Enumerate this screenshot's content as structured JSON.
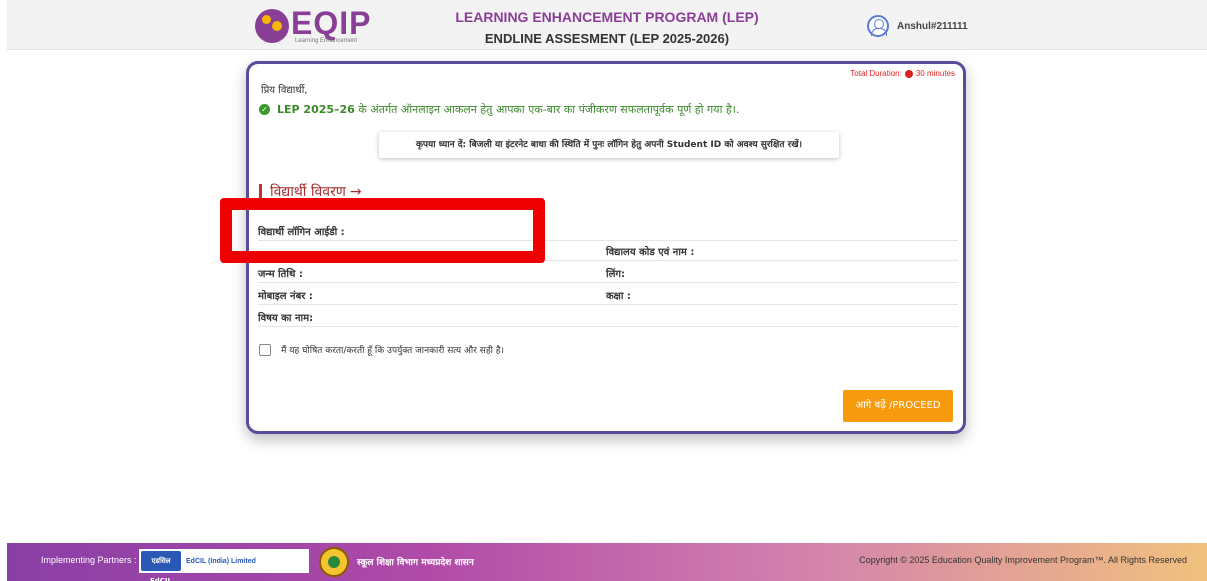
{
  "header": {
    "logo_text": "EQIP",
    "logo_subtitle": "Learning Enhancement",
    "title_line1": "LEARNING ENHANCEMENT PROGRAM (LEP)",
    "title_line2": "ENDLINE ASSESMENT (LEP 2025-2026)",
    "username": "Anshul#211111"
  },
  "card": {
    "duration_label": "Total Duration:",
    "duration_value": "30 minutes",
    "greeting": "प्रिय विद्यार्थी,",
    "success_bold": "LEP 2025–26",
    "success_message": "के अंतर्गत ऑनलाइन आकलन हेतु आपका एक-बार का पंजीकरण सफलतापूर्वक पूर्ण हो गया है।.",
    "notice": "कृपया ध्यान दें: बिजली या इंटरनेट बाधा की स्थिति में पुनः लॉगिन हेतु अपनी Student ID को अवश्य सुरक्षित रखें।",
    "section_title": "विद्यार्थी विवरण",
    "section_arrow": "→",
    "fields": {
      "login_id": "विद्यार्थी लॉगिन आईडी :",
      "school": "विद्यालय कोड एवं नाम :",
      "dob": "जन्म तिथि :",
      "gender": "लिंग:",
      "mobile": "मोबाइल नंबर :",
      "class": "कक्षा :",
      "subject": "विषय का नाम:"
    },
    "declaration": "मैं यह घोषित करता/करती हूँ कि उपर्युक्त जानकारी सत्य और सही है।",
    "proceed_label": "आगे बढ़ें /PROCEED"
  },
  "footer": {
    "partners_label": "Implementing Partners :",
    "edcil_icon_text": "एडसिल EdCIL",
    "edcil_name": "EdCIL (India) Limited",
    "mp_text": "स्कूल शिक्षा विभाग मध्यप्रदेश शासन",
    "copyright": "Copyright © 2025 Education Quality Improvement Program™. All Rights Reserved"
  },
  "colors": {
    "brand": "#8a3f97",
    "proceed": "#f79a0e",
    "highlight": "#ee0000",
    "success": "#3a8a2a",
    "card_border": "#5b4b9a"
  },
  "icons": [
    "eqip-logo",
    "user-avatar-icon",
    "clock-icon",
    "check-circle-icon",
    "edcil-logo",
    "mp-emblem"
  ]
}
